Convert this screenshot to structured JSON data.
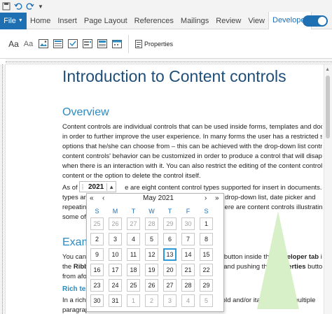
{
  "ribbon": {
    "file_label": "File",
    "tabs": [
      "Home",
      "Insert",
      "Page Layout",
      "References",
      "Mailings",
      "Review",
      "View",
      "Developer"
    ],
    "active_tab": "Developer",
    "icons": [
      "Aa",
      "Aa"
    ],
    "properties_label": "Properties"
  },
  "document": {
    "title": "Introduction to Content controls",
    "overview_heading": "Overview",
    "overview_lines": [
      "Content controls are individual controls that can be used inside forms, templates and documer",
      "in order to further improve the user experience. In many forms the user has a restricted set of",
      "options that he/she can choose from – this can be achieved with the drop-down list control. Th",
      "content controls' behavior can be customized in order to produce a control that will disappear",
      "when there is an interaction with it. You can also restrict the editing of the content controls'",
      "content or the option to delete the control itself."
    ],
    "para2_start": "As of F",
    "para2_rest": "e are eight content control types supported for insert in documents. These",
    "para2_line2a": "types are",
    "para2_line2b": "x, drop-down list, date picker and",
    "para2_line3a": "repeating",
    "para2_line3b": "there are content controls illustratin",
    "para2_line4a": "some of t",
    "example_heading": "Exam",
    "ex_line1a": "You can a",
    "ex_line1b": "button inside the ",
    "ex_line1c": "Developer tab",
    "ex_line1d": " in",
    "ex_line2a": "the ",
    "ex_line2b": "Ribb",
    "ex_line2c": "t and pushing the ",
    "ex_line2d": "Properties",
    "ex_line2e": " butto",
    "ex_line3a": "from afor",
    "rich_heading": "Rich tex",
    "rich_line1a": "In a rich",
    "rich_line1b": "old and/or italic or have multiple",
    "rich_line2a": "paragrap"
  },
  "year_control": {
    "value": "2021"
  },
  "calendar": {
    "nav_prev_year": "«",
    "nav_prev_month": "‹",
    "month_label": "May 2021",
    "nav_next_month": "›",
    "nav_next_year": "»",
    "weekdays": [
      "S",
      "M",
      "T",
      "W",
      "T",
      "F",
      "S"
    ],
    "weeks": [
      [
        "25",
        "26",
        "27",
        "28",
        "29",
        "30",
        "1"
      ],
      [
        "2",
        "3",
        "4",
        "5",
        "6",
        "7",
        "8"
      ],
      [
        "9",
        "10",
        "11",
        "12",
        "13",
        "14",
        "15"
      ],
      [
        "16",
        "17",
        "18",
        "19",
        "20",
        "21",
        "22"
      ],
      [
        "23",
        "24",
        "25",
        "26",
        "27",
        "28",
        "29"
      ],
      [
        "30",
        "31",
        "1",
        "2",
        "3",
        "4",
        "5"
      ]
    ],
    "selected_day": "13",
    "accent": "#2e9bd6"
  },
  "colors": {
    "brand": "#1f6fb3",
    "heading": "#1f4e79",
    "subheading": "#2e8bc0"
  }
}
